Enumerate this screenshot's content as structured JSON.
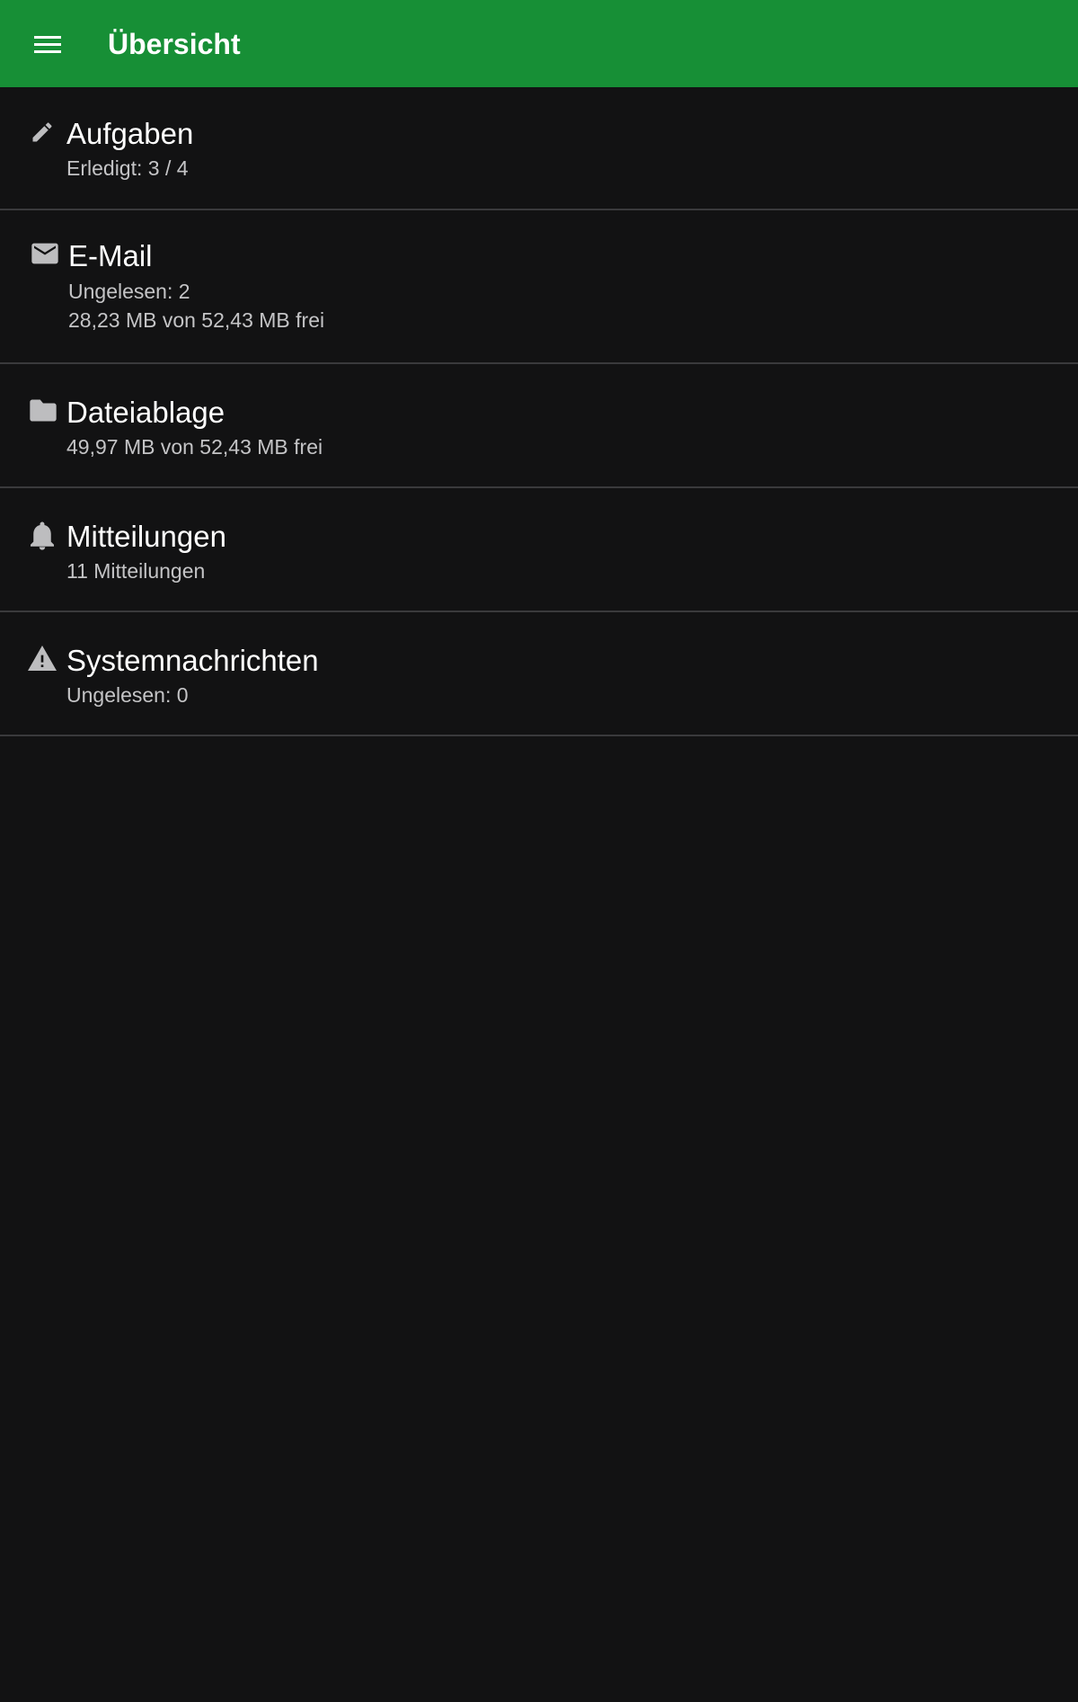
{
  "toolbar": {
    "title": "Übersicht",
    "menu_icon": "hamburger-menu-icon",
    "color": "#178f36"
  },
  "theme": {
    "background": "#121213",
    "divider": "#3a3a3c",
    "icon_color": "#bdbdbf"
  },
  "items": [
    {
      "icon": "pencil-icon",
      "title": "Aufgaben",
      "lines": [
        "Erledigt: 3 / 4"
      ]
    },
    {
      "icon": "mail-icon",
      "title": "E-Mail",
      "lines": [
        "Ungelesen: 2",
        "28,23 MB von 52,43 MB frei"
      ]
    },
    {
      "icon": "folder-icon",
      "title": "Dateiablage",
      "lines": [
        "49,97 MB von 52,43 MB frei"
      ]
    },
    {
      "icon": "bell-icon",
      "title": "Mitteilungen",
      "lines": [
        "11 Mitteilungen"
      ]
    },
    {
      "icon": "warning-icon",
      "title": "Systemnachrichten",
      "lines": [
        "Ungelesen: 0"
      ]
    }
  ]
}
